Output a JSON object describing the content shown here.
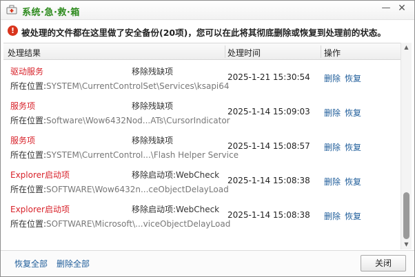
{
  "window": {
    "title": "系统·急·救·箱",
    "min_symbol": "—",
    "close_symbol": "✕",
    "title_color": "#2e8b1e"
  },
  "notice": {
    "icon_symbol": "!",
    "text": "被处理的文件都在这里做了安全备份(20项)，您可以在此将其彻底删除或恢复到处理前的状态。"
  },
  "table": {
    "columns": [
      "处理结果",
      "处理时间",
      "操作"
    ],
    "rows": [
      {
        "name": "驱动服务",
        "action": "移除残缺项",
        "loc_label": "所在位置:",
        "loc_path": "SYSTEM\\CurrentControlSet\\Services\\ksapi64",
        "time": "2025-1-21 15:30:54",
        "delete": "删除",
        "restore": "恢复"
      },
      {
        "name": "服务项",
        "action": "移除残缺项",
        "loc_label": "所在位置:",
        "loc_path": "Software\\Wow6432Nod...ATs\\CursorIndicator",
        "time": "2025-1-14 15:09:03",
        "delete": "删除",
        "restore": "恢复"
      },
      {
        "name": "服务项",
        "action": "移除残缺项",
        "loc_label": "所在位置:",
        "loc_path": "SYSTEM\\CurrentControl...\\Flash Helper Service",
        "time": "2025-1-14 15:08:57",
        "delete": "删除",
        "restore": "恢复"
      },
      {
        "name": "Explorer启动项",
        "action": "移除启动项:WebCheck",
        "loc_label": "所在位置:",
        "loc_path": "SOFTWARE\\Wow6432n...ceObjectDelayLoad",
        "time": "2025-1-14 15:08:38",
        "delete": "删除",
        "restore": "恢复"
      },
      {
        "name": "Explorer启动项",
        "action": "移除启动项:WebCheck",
        "loc_label": "所在位置:",
        "loc_path": "SOFTWARE\\Microsoft\\...viceObjectDelayLoad",
        "time": "2025-1-14 15:08:38",
        "delete": "删除",
        "restore": "恢复"
      }
    ]
  },
  "footer": {
    "restore_all": "恢复全部",
    "delete_all": "删除全部",
    "close": "关闭"
  },
  "colors": {
    "item_name": "#d8222a",
    "link": "#1f5d9a",
    "notice_icon": "#d9341c"
  }
}
